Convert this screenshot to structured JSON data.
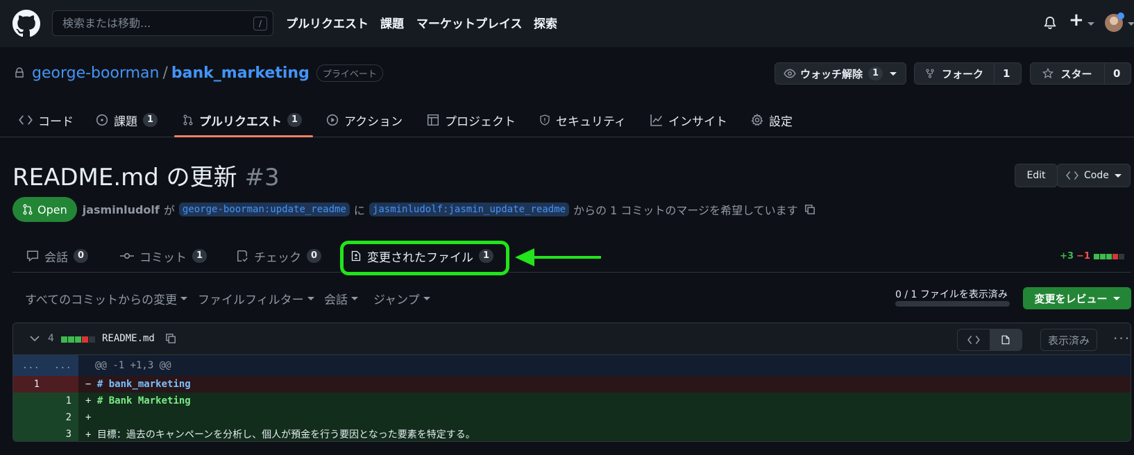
{
  "header": {
    "search_placeholder": "検索または移動...",
    "search_key": "/",
    "nav": [
      "プルリクエスト",
      "課題",
      "マーケットプレイス",
      "探索"
    ],
    "plus_label": "+"
  },
  "repo": {
    "owner": "george-boorman",
    "separator": "/",
    "name": "bank_marketing",
    "visibility": "プライベート",
    "watch": {
      "label": "ウォッチ解除",
      "count": "1"
    },
    "fork": {
      "label": "フォーク",
      "count": "1"
    },
    "star": {
      "label": "スター",
      "count": "0"
    }
  },
  "repo_tabs": [
    {
      "label": "コード"
    },
    {
      "label": "課題",
      "count": "1"
    },
    {
      "label": "プルリクエスト",
      "count": "1"
    },
    {
      "label": "アクション"
    },
    {
      "label": "プロジェクト"
    },
    {
      "label": "セキュリティ"
    },
    {
      "label": "インサイト"
    },
    {
      "label": "設定"
    }
  ],
  "pr": {
    "title": "README.md の更新",
    "number": "#3",
    "edit_label": "Edit",
    "code_label": "Code",
    "state": "Open",
    "author": "jasminludolf",
    "particle_ga": "が",
    "base_branch": "george-boorman:update_readme",
    "particle_ni": "に",
    "head_branch": "jasminludolf:jasmin_update_readme",
    "description": "からの 1 コミットのマージを希望しています"
  },
  "pr_tabs": [
    {
      "label": "会話",
      "count": "0"
    },
    {
      "label": "コミット",
      "count": "1"
    },
    {
      "label": "チェック",
      "count": "0"
    },
    {
      "label": "変更されたファイル",
      "count": "1"
    }
  ],
  "diffstat": {
    "additions": "+3",
    "deletions": "−1"
  },
  "toolbar": {
    "commits_filter": "すべてのコミットからの変更",
    "file_filter": "ファイルフィルター",
    "conversations": "会話",
    "jump": "ジャンプ",
    "viewed_status": "0 / 1 ファイルを表示済み",
    "viewed_progress": 0,
    "review_button": "変更をレビュー"
  },
  "file": {
    "change_count": "4",
    "name": "README.md",
    "viewed_label": "表示済み",
    "more_label": "···"
  },
  "diff": {
    "hunk_markers": [
      "...",
      "..."
    ],
    "hunk_header": "@@ -1 +1,3 @@",
    "lines": [
      {
        "type": "del",
        "old": "1",
        "new": "",
        "sign": "−",
        "text": "# bank_marketing"
      },
      {
        "type": "add",
        "old": "",
        "new": "1",
        "sign": "+",
        "text": "# Bank Marketing"
      },
      {
        "type": "add",
        "old": "",
        "new": "2",
        "sign": "+",
        "text": ""
      },
      {
        "type": "add",
        "old": "",
        "new": "3",
        "sign": "+",
        "text": "目標：過去のキャンペーンを分析し、個人が預金を行う要因となった要素を特定する。"
      }
    ]
  },
  "colors": {
    "background": "#0d1117",
    "header": "#161b22",
    "accent_link": "#4493f8",
    "success": "#238636",
    "highlight": "#22e31c",
    "tab_underline": "#f78166"
  }
}
